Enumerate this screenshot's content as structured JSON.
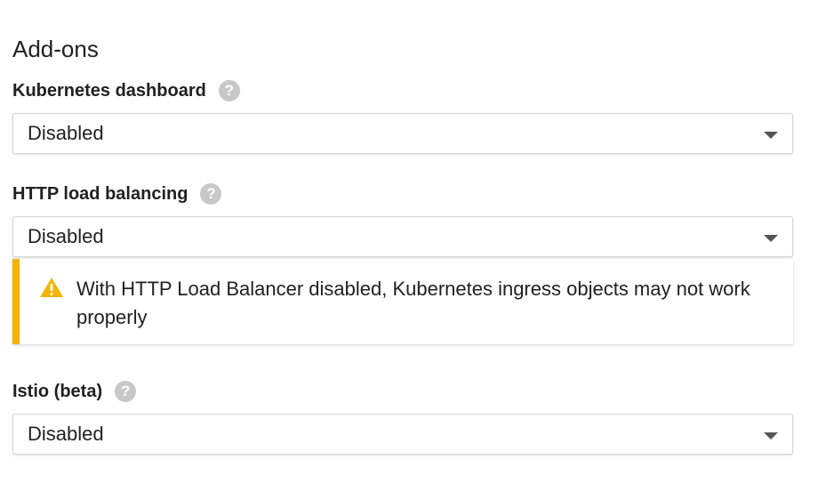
{
  "section": {
    "title": "Add-ons"
  },
  "addons": [
    {
      "label": "Kubernetes dashboard",
      "value": "Disabled"
    },
    {
      "label": "HTTP load balancing",
      "value": "Disabled"
    },
    {
      "label": "Istio (beta)",
      "value": "Disabled"
    }
  ],
  "warning": {
    "text": "With HTTP Load Balancer disabled, Kubernetes ingress objects may not work properly",
    "color": "#f4b400"
  },
  "help_icon": {
    "glyph": "?"
  }
}
